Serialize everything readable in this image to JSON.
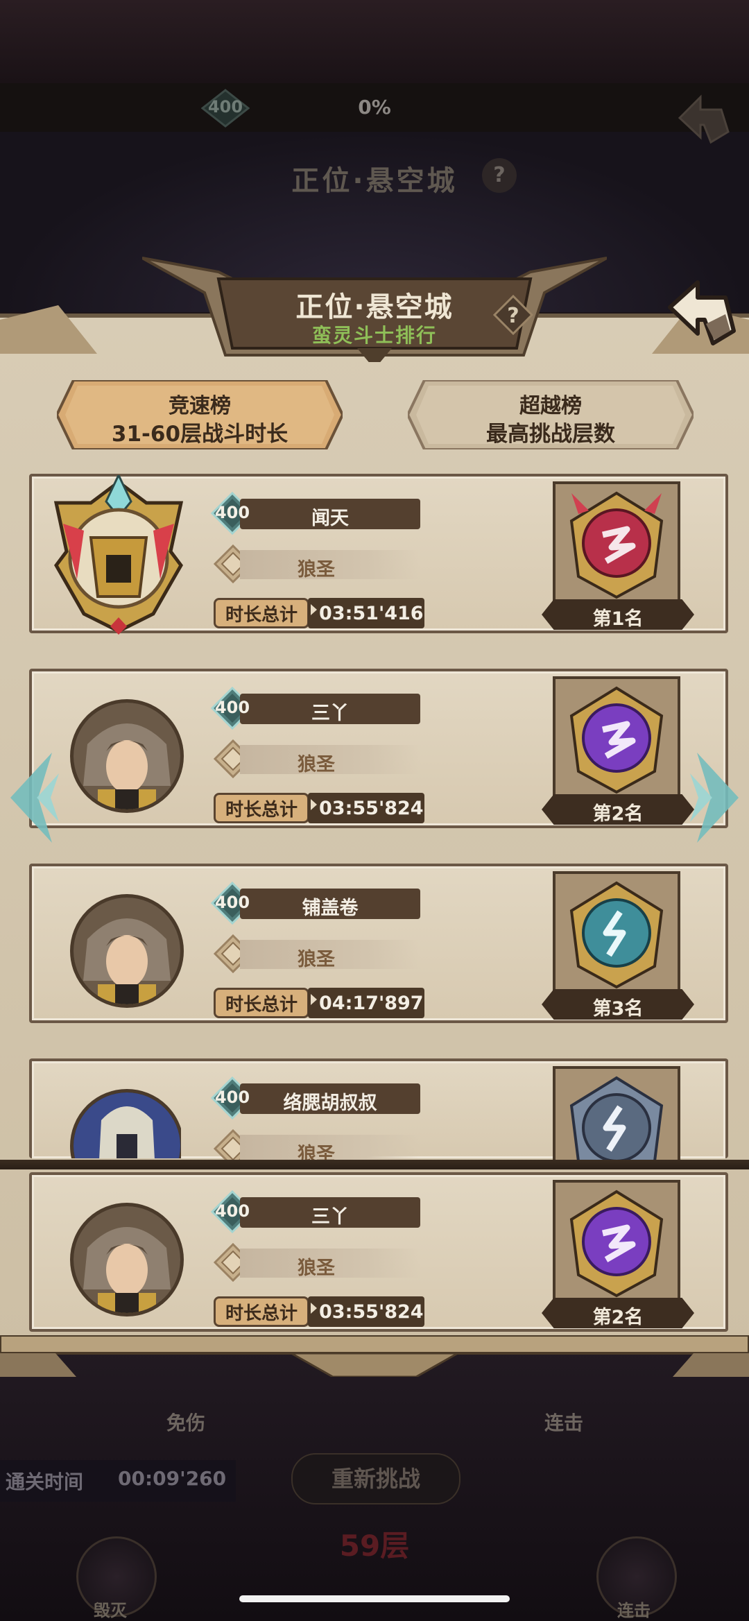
{
  "background": {
    "level_badge": "400",
    "progress_percent": "0%",
    "location_title": "正位·悬空城",
    "help_glyph": "?",
    "stat_left_label": "免伤",
    "stat_right_label": "连击",
    "clear_time_label": "通关时间",
    "clear_time_value": "00:09'260",
    "retry_label": "重新挑战",
    "floor_label": "59层",
    "skill_left_label": "毁灭",
    "skill_right_label": "连击"
  },
  "header": {
    "title": "正位·悬空城",
    "subtitle": "蛮灵斗士排行",
    "help_glyph": "?"
  },
  "tabs": [
    {
      "title": "竞速榜",
      "subtitle": "31-60层战斗时长",
      "active": true
    },
    {
      "title": "超越榜",
      "subtitle": "最高挑战层数",
      "active": false
    }
  ],
  "rankings": [
    {
      "level": "400",
      "name": "闻天",
      "title": "狼圣",
      "time_label": "时长总计",
      "time": "03:51'416",
      "rank": "第1名",
      "medal_color": "#b8304a",
      "avatar": "golden-knight"
    },
    {
      "level": "400",
      "name": "三丫",
      "title": "狼圣",
      "time_label": "时长总计",
      "time": "03:55'824",
      "rank": "第2名",
      "medal_color": "#7a3ec0",
      "avatar": "wolf-warrior"
    },
    {
      "level": "400",
      "name": "铺盖卷",
      "title": "狼圣",
      "time_label": "时长总计",
      "time": "04:17'897",
      "rank": "第3名",
      "medal_color": "#3f8e9a",
      "avatar": "wolf-warrior"
    },
    {
      "level": "400",
      "name": "络腮胡叔叔",
      "title": "狼圣",
      "time_label": "",
      "time": "",
      "rank": "",
      "medal_color": "#5a6a80",
      "avatar": "blue-knight"
    }
  ],
  "my_rank": {
    "level": "400",
    "name": "三丫",
    "title": "狼圣",
    "time_label": "时长总计",
    "time": "03:55'824",
    "rank": "第2名",
    "medal_color": "#7a3ec0",
    "avatar": "wolf-warrior"
  }
}
